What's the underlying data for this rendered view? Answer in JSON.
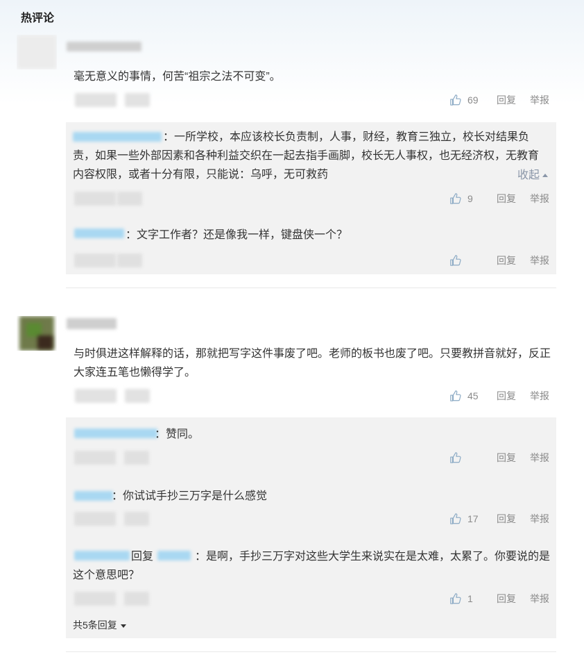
{
  "section_title": "热评论",
  "comments": [
    {
      "text": "毫无意义的事情，何苦“祖宗之法不可变”。",
      "likes": "69",
      "reply_label": "回复",
      "report_label": "举报",
      "replies": [
        {
          "text": "：一所学校，本应该校长负责制，人事，财经，教育三独立，校长对结果负责，如果一些外部因素和各种利益交织在一起去指手画脚，校长无人事权，也无经济权，无教育内容权限，或者十分有限，只能说：乌呼，无可救药",
          "collapse_label": "收起",
          "likes": "9",
          "reply_label": "回复",
          "report_label": "举报"
        },
        {
          "text": "：文字工作者？还是像我一样，键盘侠一个？",
          "likes": "",
          "reply_label": "回复",
          "report_label": "举报"
        }
      ]
    },
    {
      "text": "与时俱进这样解释的话，那就把写字这件事废了吧。老师的板书也废了吧。只要教拼音就好，反正大家连五笔也懒得学了。",
      "likes": "45",
      "reply_label": "回复",
      "report_label": "举报",
      "replies": [
        {
          "text": "：赞同。",
          "likes": "",
          "reply_label": "回复",
          "report_label": "举报"
        },
        {
          "text": "：你试试手抄三万字是什么感觉",
          "likes": "17",
          "reply_label": "回复",
          "report_label": "举报"
        },
        {
          "reply_to_word": "回复",
          "text": "：是啊，手抄三万字对这些大学生来说实在是太难，太累了。你要说的是这个意思吧？",
          "likes": "1",
          "reply_label": "回复",
          "report_label": "举报"
        }
      ],
      "more_replies_label": "共5条回复"
    }
  ],
  "colors": {
    "accent_blue_blur": "#a9d8f2",
    "sub_bg": "#f2f2f2",
    "collapse": "#8a96a8"
  }
}
